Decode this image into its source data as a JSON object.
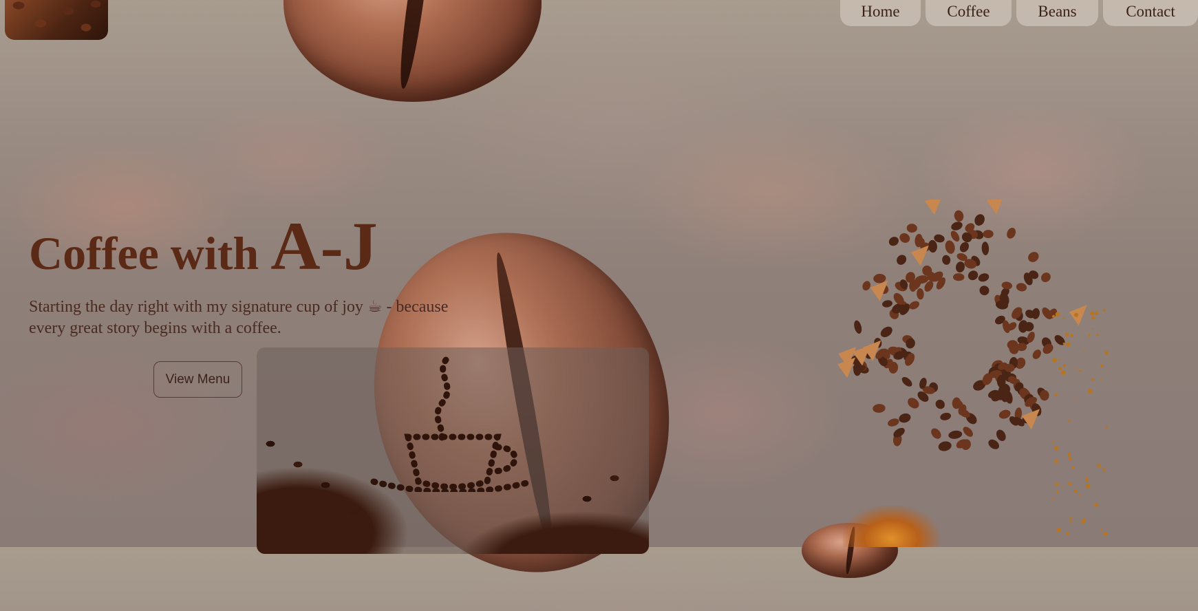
{
  "nav": {
    "items": [
      {
        "label": "Home"
      },
      {
        "label": "Coffee"
      },
      {
        "label": "Beans"
      },
      {
        "label": "Contact"
      }
    ]
  },
  "hero": {
    "title_main": "Coffee with ",
    "title_name": "A-J",
    "tagline_part1": "Starting the day right with my signature cup of joy ",
    "tagline_icon": "☕",
    "tagline_part2": " - because every great story begins with a coffee.",
    "menu_button_label": "View Menu"
  },
  "icons": {
    "logo": "coffee-beans-logo-icon",
    "cup": "hot-beverage-icon"
  },
  "colors": {
    "title": "#5b2a17",
    "text": "#4a2a20",
    "nav_bg": "#cdc1b7",
    "background": "#9a8b82"
  }
}
